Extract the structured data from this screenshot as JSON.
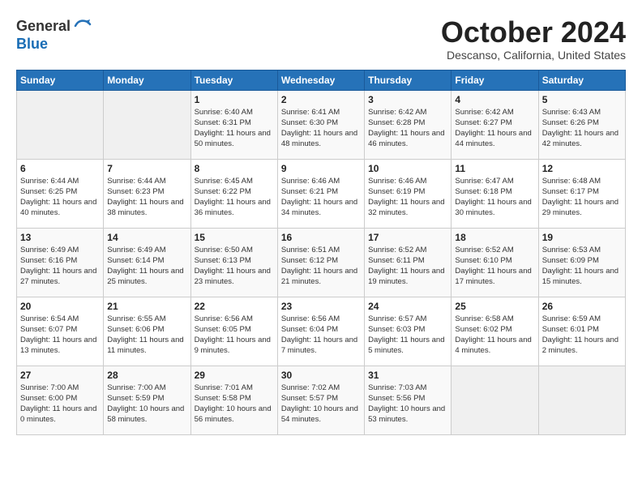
{
  "logo": {
    "general": "General",
    "blue": "Blue"
  },
  "header": {
    "month": "October 2024",
    "location": "Descanso, California, United States"
  },
  "weekdays": [
    "Sunday",
    "Monday",
    "Tuesday",
    "Wednesday",
    "Thursday",
    "Friday",
    "Saturday"
  ],
  "weeks": [
    [
      {
        "day": "",
        "sunrise": "",
        "sunset": "",
        "daylight": ""
      },
      {
        "day": "",
        "sunrise": "",
        "sunset": "",
        "daylight": ""
      },
      {
        "day": "1",
        "sunrise": "Sunrise: 6:40 AM",
        "sunset": "Sunset: 6:31 PM",
        "daylight": "Daylight: 11 hours and 50 minutes."
      },
      {
        "day": "2",
        "sunrise": "Sunrise: 6:41 AM",
        "sunset": "Sunset: 6:30 PM",
        "daylight": "Daylight: 11 hours and 48 minutes."
      },
      {
        "day": "3",
        "sunrise": "Sunrise: 6:42 AM",
        "sunset": "Sunset: 6:28 PM",
        "daylight": "Daylight: 11 hours and 46 minutes."
      },
      {
        "day": "4",
        "sunrise": "Sunrise: 6:42 AM",
        "sunset": "Sunset: 6:27 PM",
        "daylight": "Daylight: 11 hours and 44 minutes."
      },
      {
        "day": "5",
        "sunrise": "Sunrise: 6:43 AM",
        "sunset": "Sunset: 6:26 PM",
        "daylight": "Daylight: 11 hours and 42 minutes."
      }
    ],
    [
      {
        "day": "6",
        "sunrise": "Sunrise: 6:44 AM",
        "sunset": "Sunset: 6:25 PM",
        "daylight": "Daylight: 11 hours and 40 minutes."
      },
      {
        "day": "7",
        "sunrise": "Sunrise: 6:44 AM",
        "sunset": "Sunset: 6:23 PM",
        "daylight": "Daylight: 11 hours and 38 minutes."
      },
      {
        "day": "8",
        "sunrise": "Sunrise: 6:45 AM",
        "sunset": "Sunset: 6:22 PM",
        "daylight": "Daylight: 11 hours and 36 minutes."
      },
      {
        "day": "9",
        "sunrise": "Sunrise: 6:46 AM",
        "sunset": "Sunset: 6:21 PM",
        "daylight": "Daylight: 11 hours and 34 minutes."
      },
      {
        "day": "10",
        "sunrise": "Sunrise: 6:46 AM",
        "sunset": "Sunset: 6:19 PM",
        "daylight": "Daylight: 11 hours and 32 minutes."
      },
      {
        "day": "11",
        "sunrise": "Sunrise: 6:47 AM",
        "sunset": "Sunset: 6:18 PM",
        "daylight": "Daylight: 11 hours and 30 minutes."
      },
      {
        "day": "12",
        "sunrise": "Sunrise: 6:48 AM",
        "sunset": "Sunset: 6:17 PM",
        "daylight": "Daylight: 11 hours and 29 minutes."
      }
    ],
    [
      {
        "day": "13",
        "sunrise": "Sunrise: 6:49 AM",
        "sunset": "Sunset: 6:16 PM",
        "daylight": "Daylight: 11 hours and 27 minutes."
      },
      {
        "day": "14",
        "sunrise": "Sunrise: 6:49 AM",
        "sunset": "Sunset: 6:14 PM",
        "daylight": "Daylight: 11 hours and 25 minutes."
      },
      {
        "day": "15",
        "sunrise": "Sunrise: 6:50 AM",
        "sunset": "Sunset: 6:13 PM",
        "daylight": "Daylight: 11 hours and 23 minutes."
      },
      {
        "day": "16",
        "sunrise": "Sunrise: 6:51 AM",
        "sunset": "Sunset: 6:12 PM",
        "daylight": "Daylight: 11 hours and 21 minutes."
      },
      {
        "day": "17",
        "sunrise": "Sunrise: 6:52 AM",
        "sunset": "Sunset: 6:11 PM",
        "daylight": "Daylight: 11 hours and 19 minutes."
      },
      {
        "day": "18",
        "sunrise": "Sunrise: 6:52 AM",
        "sunset": "Sunset: 6:10 PM",
        "daylight": "Daylight: 11 hours and 17 minutes."
      },
      {
        "day": "19",
        "sunrise": "Sunrise: 6:53 AM",
        "sunset": "Sunset: 6:09 PM",
        "daylight": "Daylight: 11 hours and 15 minutes."
      }
    ],
    [
      {
        "day": "20",
        "sunrise": "Sunrise: 6:54 AM",
        "sunset": "Sunset: 6:07 PM",
        "daylight": "Daylight: 11 hours and 13 minutes."
      },
      {
        "day": "21",
        "sunrise": "Sunrise: 6:55 AM",
        "sunset": "Sunset: 6:06 PM",
        "daylight": "Daylight: 11 hours and 11 minutes."
      },
      {
        "day": "22",
        "sunrise": "Sunrise: 6:56 AM",
        "sunset": "Sunset: 6:05 PM",
        "daylight": "Daylight: 11 hours and 9 minutes."
      },
      {
        "day": "23",
        "sunrise": "Sunrise: 6:56 AM",
        "sunset": "Sunset: 6:04 PM",
        "daylight": "Daylight: 11 hours and 7 minutes."
      },
      {
        "day": "24",
        "sunrise": "Sunrise: 6:57 AM",
        "sunset": "Sunset: 6:03 PM",
        "daylight": "Daylight: 11 hours and 5 minutes."
      },
      {
        "day": "25",
        "sunrise": "Sunrise: 6:58 AM",
        "sunset": "Sunset: 6:02 PM",
        "daylight": "Daylight: 11 hours and 4 minutes."
      },
      {
        "day": "26",
        "sunrise": "Sunrise: 6:59 AM",
        "sunset": "Sunset: 6:01 PM",
        "daylight": "Daylight: 11 hours and 2 minutes."
      }
    ],
    [
      {
        "day": "27",
        "sunrise": "Sunrise: 7:00 AM",
        "sunset": "Sunset: 6:00 PM",
        "daylight": "Daylight: 11 hours and 0 minutes."
      },
      {
        "day": "28",
        "sunrise": "Sunrise: 7:00 AM",
        "sunset": "Sunset: 5:59 PM",
        "daylight": "Daylight: 10 hours and 58 minutes."
      },
      {
        "day": "29",
        "sunrise": "Sunrise: 7:01 AM",
        "sunset": "Sunset: 5:58 PM",
        "daylight": "Daylight: 10 hours and 56 minutes."
      },
      {
        "day": "30",
        "sunrise": "Sunrise: 7:02 AM",
        "sunset": "Sunset: 5:57 PM",
        "daylight": "Daylight: 10 hours and 54 minutes."
      },
      {
        "day": "31",
        "sunrise": "Sunrise: 7:03 AM",
        "sunset": "Sunset: 5:56 PM",
        "daylight": "Daylight: 10 hours and 53 minutes."
      },
      {
        "day": "",
        "sunrise": "",
        "sunset": "",
        "daylight": ""
      },
      {
        "day": "",
        "sunrise": "",
        "sunset": "",
        "daylight": ""
      }
    ]
  ]
}
